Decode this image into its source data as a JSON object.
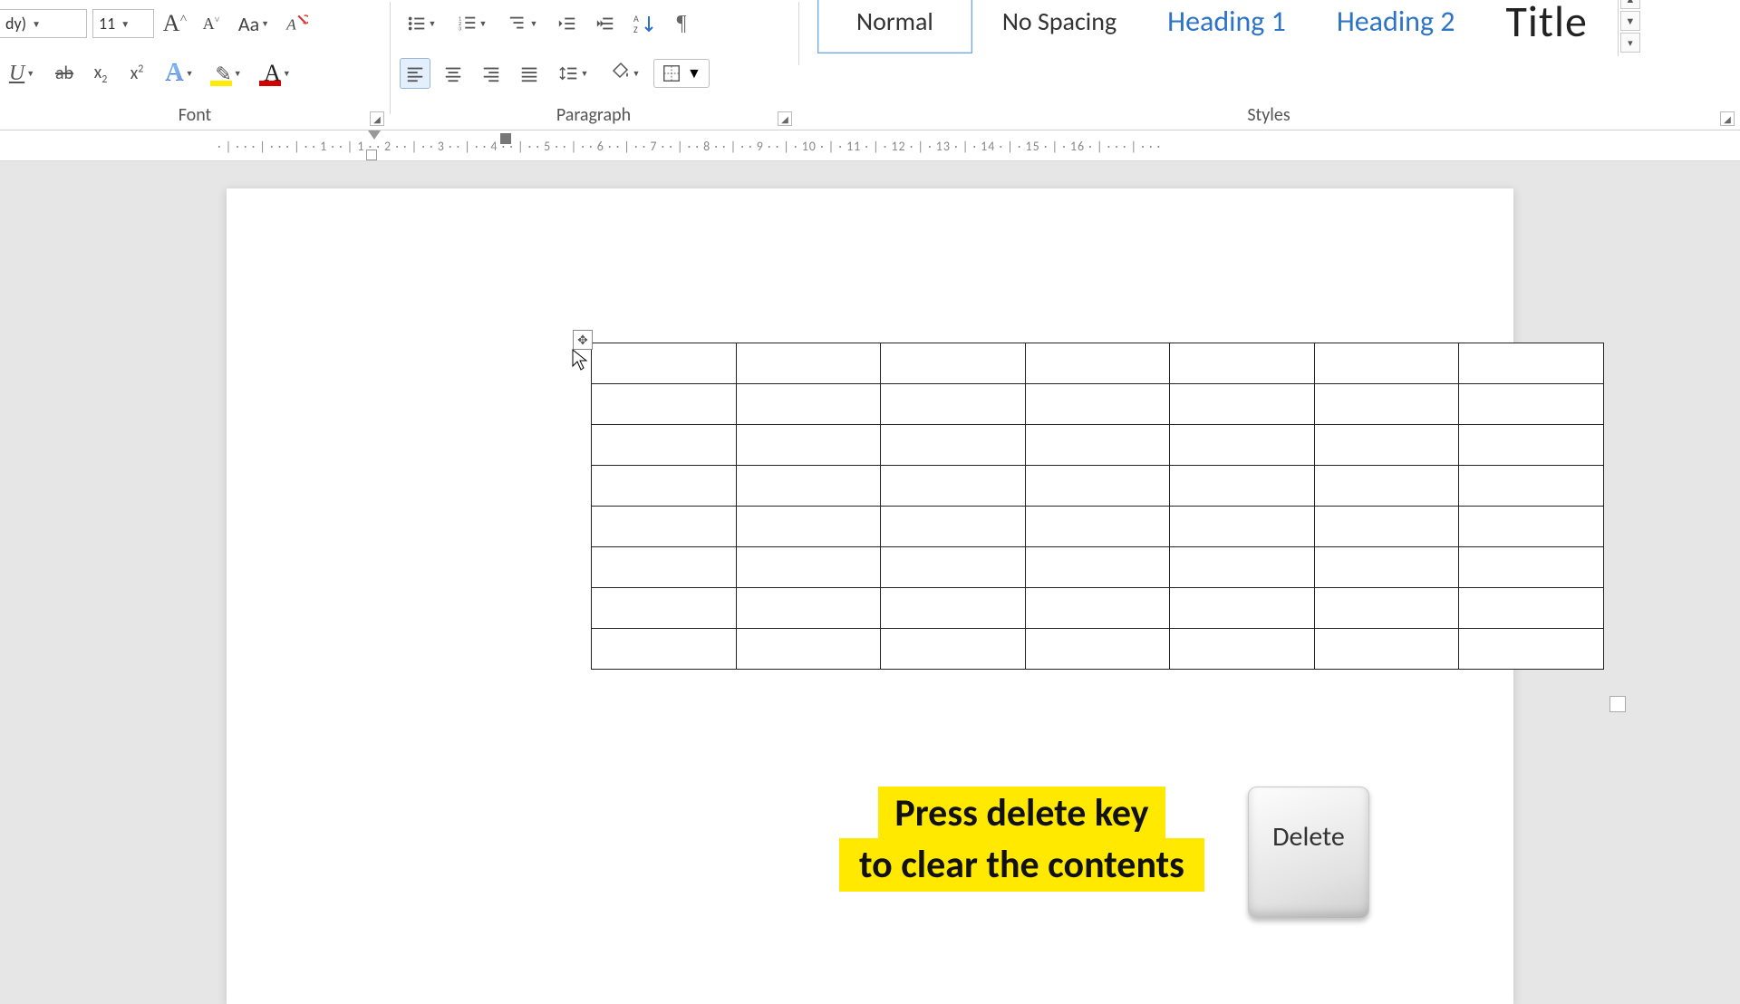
{
  "ribbon": {
    "font_name_partial": "dy)",
    "font_size": "11",
    "case_label": "Aa",
    "group_font": "Font",
    "group_paragraph": "Paragraph",
    "group_styles": "Styles"
  },
  "styles": {
    "normal": "Normal",
    "no_spacing": "No Spacing",
    "heading1": "Heading 1",
    "heading2": "Heading 2",
    "title": "Title"
  },
  "ruler": {
    "ticks": "· | · · · | · · · | · · 1 · · | 1 · · 2 · · | · · 3 · · | · · 4 · · | · · 5 · · | · · 6 · · | · · 7 · · | · · 8 · · | · · 9 · · | · 10 · | · 11 · | · 12 · | · 13 · | · 14 · | · 15 · | · 16 · | · · · | · · ·"
  },
  "table": {
    "rows": 8,
    "cols": 7
  },
  "annotation": {
    "line1": "Press delete key",
    "line2": "to clear the contents",
    "key_label": "Delete"
  }
}
